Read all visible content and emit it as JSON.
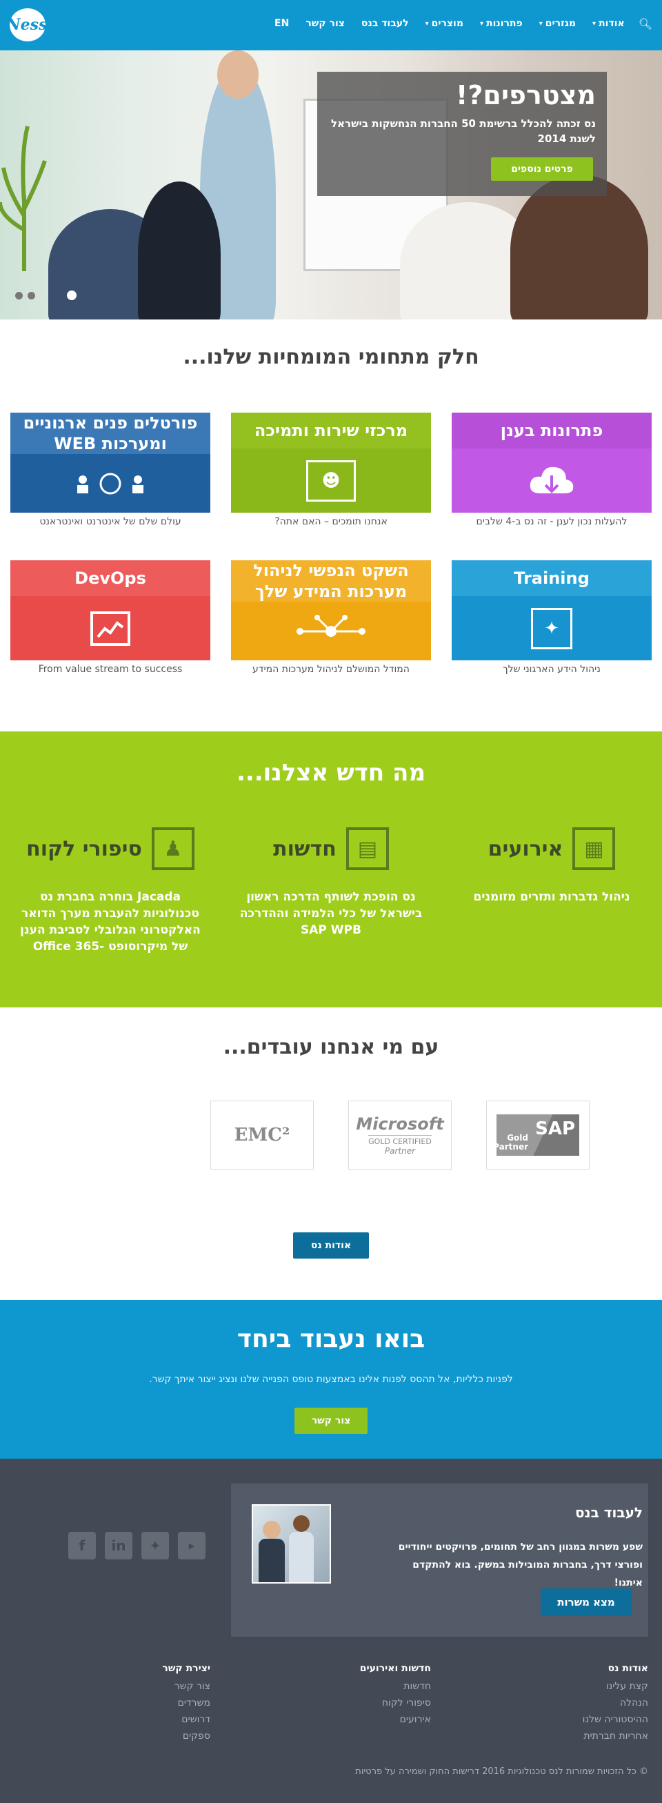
{
  "header": {
    "logo_text": "Ness",
    "nav": [
      {
        "label": "אודות",
        "dropdown": true
      },
      {
        "label": "מגזרים",
        "dropdown": true
      },
      {
        "label": "פתרונות",
        "dropdown": true
      },
      {
        "label": "מוצרים",
        "dropdown": true
      },
      {
        "label": "לעבוד בנס",
        "dropdown": false
      },
      {
        "label": "צור קשר",
        "dropdown": false
      },
      {
        "label": "EN",
        "dropdown": false
      }
    ],
    "search_icon": "search-icon"
  },
  "hero": {
    "title": "מצטרפים?!",
    "text": "נס זכתה להכלל ברשימת 50 החברות הנחשקות בישראל לשנת 2014",
    "button": "פרטים נוספים",
    "slides": 3
  },
  "expertise": {
    "title": "חלק מתחומי המומחיות שלנו...",
    "cards": [
      {
        "title": "פתרונות בענן",
        "caption": "להעלות נכון לענן - זה נס ב-4 שלבים",
        "icon": "cloud-upload-icon",
        "color": "#b650d9",
        "body_color": "#c158e6"
      },
      {
        "title": "מרכזי שירות ותמיכה",
        "caption": "אנחנו תומכים – האם אתה?",
        "icon": "support-agent-icon",
        "color": "#94c11f",
        "body_color": "#8ab71a"
      },
      {
        "title": "פורטלים פנים ארגוניים ומערכות WEB",
        "caption": "עולם שלם של אינטרנט ואינטראנט",
        "icon": "network-users-icon",
        "color": "#3a78b6",
        "body_color": "#1f5f9e"
      },
      {
        "title": "Training",
        "caption": "ניהול הידע הארגוני שלך",
        "icon": "presentation-icon",
        "color": "#2aa3d9",
        "body_color": "#1793cf"
      },
      {
        "title": "השקט הנפשי לניהול מערכות המידע שלך",
        "caption": "המודל המושלם לניהול מערכות המידע",
        "icon": "hub-nodes-icon",
        "color": "#f3b22c",
        "body_color": "#f0a812"
      },
      {
        "title": "DevOps",
        "caption": "From value stream to success",
        "icon": "trend-chart-icon",
        "color": "#ee5b5b",
        "body_color": "#e94b4b"
      }
    ]
  },
  "news": {
    "title": "מה חדש אצלנו...",
    "cols": [
      {
        "title": "אירועים",
        "text": "ניהול גדברות ותזרים מזומנים",
        "icon": "calendar-icon"
      },
      {
        "title": "חדשות",
        "text": "נס הופכת לשותף הדרכה ראשון בישראל של כלי הלמידה וההדרכה SAP WPB",
        "icon": "newspaper-icon"
      },
      {
        "title": "סיפורי לקוח",
        "text": "Jacada בוחרה בחברת נס טכנולוגיות להעברת מערך הדואר האלקטרוני הגלובלי לסביבת הענן של מיקרוסופט -Office 365",
        "icon": "client-story-icon"
      }
    ]
  },
  "partners": {
    "title": "עם מי אנחנו עובדים...",
    "logos": [
      {
        "name": "SAP",
        "sub": "Gold Partner"
      },
      {
        "name": "Microsoft",
        "sub": "GOLD CERTIFIED",
        "sub2": "Partner"
      },
      {
        "name": "EMC²"
      }
    ],
    "about_button": "אודות נס"
  },
  "cta": {
    "title": "בואו נעבוד ביחד",
    "text": "לפניות כלליות, אל תהסס לפנות אלינו באמצעות טופס הפנייה שלנו ונציג ייצור איתך קשר.",
    "button": "צור קשר"
  },
  "footer": {
    "career_title": "לעבוד בנס",
    "career_text": "שפע משרות במגוון רחב של תחומים, פרויקטים ייחודיים ופורצי דרך, בחברות המובילות במשק. בוא להתקדם איתנו!",
    "career_button": "מצא משרות",
    "social": [
      "youtube-icon",
      "twitter-icon",
      "linkedin-icon",
      "facebook-icon"
    ],
    "columns": [
      {
        "title": "אודות נס",
        "links": [
          "קצת עלינו",
          "הנהלה",
          "ההיסטוריה שלנו",
          "אחריות חברתית"
        ]
      },
      {
        "title": "חדשות ואירועים",
        "links": [
          "חדשות",
          "סיפורי לקוח",
          "אירועים"
        ]
      },
      {
        "title": "יצירת קשר",
        "links": [
          "צור קשר",
          "משרדים",
          "דרושים",
          "ספקים"
        ]
      }
    ],
    "copyright": "© כל הזכויות שמורות לנס טכנולוגיות 2016 דרישות החוק ושמירה על פרטיות"
  }
}
